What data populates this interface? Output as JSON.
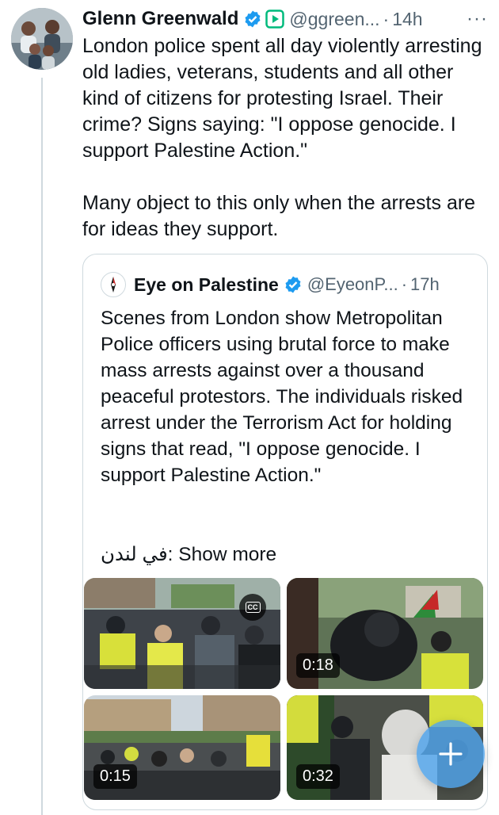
{
  "tweet": {
    "author_name": "Glenn Greenwald",
    "handle": "@ggreen...",
    "separator": "·",
    "time": "14h",
    "more_label": "···",
    "text": "London police spent all day violently arresting old ladies, veterans, students and all other kind of citizens for protesting Israel. Their crime? Signs saying: \"I oppose genocide. I support Palestine Action.\"\n\nMany object to this only when the arrests are for ideas they support."
  },
  "quote": {
    "author_name": "Eye on Palestine",
    "handle": "@EyeonP...",
    "separator": "·",
    "time": "17h",
    "text": "Scenes from London show Metropolitan Police officers using brutal force to make mass arrests against over a thousand peaceful protestors. The individuals risked arrest under the Terrorism Act for holding signs that read, \"I oppose genocide. I support Palestine Action.\"",
    "show_more": "في لندن: Show more",
    "media": [
      {
        "duration": "",
        "cc_label": "CC"
      },
      {
        "duration": "0:18"
      },
      {
        "duration": "0:15"
      },
      {
        "duration": "0:32"
      }
    ]
  },
  "fab": {
    "icon": "plus-icon"
  },
  "colors": {
    "verified_blue": "#1d9bf0",
    "subscription_green": "#00ba7c",
    "secondary_text": "#536471",
    "border": "#cfd9de",
    "fab": "#4fa4eb"
  }
}
